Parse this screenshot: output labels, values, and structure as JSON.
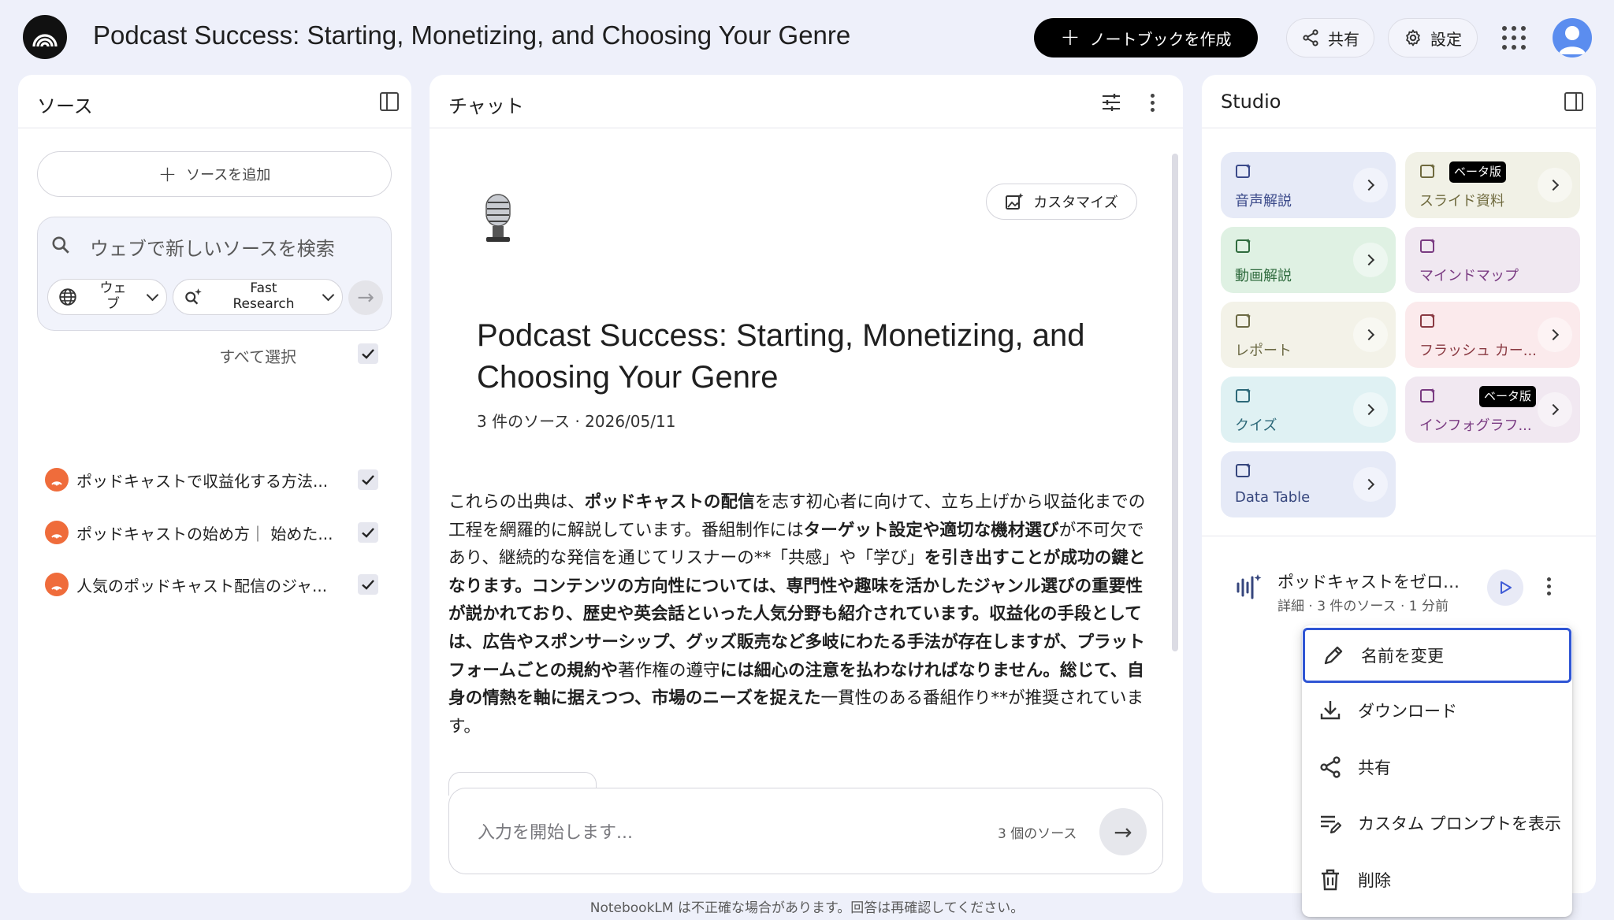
{
  "header": {
    "notebook_title": "Podcast Success: Starting, Monetizing, and Choosing Your Genre",
    "create_label": "ノートブックを作成",
    "share_label": "共有",
    "settings_label": "設定"
  },
  "sources": {
    "title": "ソース",
    "add_label": "ソースを追加",
    "search_placeholder": "ウェブで新しいソースを検索",
    "chip_web": "ウェ\nブ",
    "chip_fast": "Fast\nResearch",
    "select_all": "すべて選択",
    "items": [
      {
        "name": "ポッドキャストで収益化する方法..."
      },
      {
        "name": "ポッドキャストの始め方｜ 始めた..."
      },
      {
        "name": "人気のポッドキャスト配信のジャ..."
      }
    ]
  },
  "chat": {
    "title": "チャット",
    "customize_label": "カスタマイズ",
    "notebook_heading": "Podcast Success: Starting, Monetizing, and Choosing Your Genre",
    "meta": "3 件のソース · 2026/05/11",
    "summary": [
      {
        "t": "これらの出典は、",
        "b": false
      },
      {
        "t": "ポッドキャストの配信",
        "b": true
      },
      {
        "t": "を志す初心者に向けて、立ち上げから収益化までの工程を網羅的に解説しています。番組制作には",
        "b": false
      },
      {
        "t": "ターゲット設定や適切な機材選び",
        "b": true
      },
      {
        "t": "が不可欠であり、継続的な発信を通じてリスナーの**「共感」や「学び」",
        "b": false
      },
      {
        "t": "を引き出すことが成功の鍵となります。コンテンツの方向性については、専門性や趣味を活かしたジャンル選びの重要性が説かれており、歴史や英会話といった人気分野も紹介されています。収益化の手段としては、広告やスポンサーシップ、グッズ販売など多岐にわたる手法が存在しますが、プラットフォームごとの規約や",
        "b": true
      },
      {
        "t": "著作権の遵守",
        "b": false
      },
      {
        "t": "には細心の注意を払わなければなりません。総じて、自身の情熱を軸に据えつつ、市場のニーズを捉えた",
        "b": true
      },
      {
        "t": "一貫性のある番組作り**が推奨されています。",
        "b": false
      }
    ],
    "input_placeholder": "入力を開始します...",
    "source_count": "3 個のソース"
  },
  "studio": {
    "title": "Studio",
    "tiles": [
      {
        "label": "音声解説",
        "bg": "#e6eaf7",
        "fg": "#3b4a8a",
        "arrow": true
      },
      {
        "label": "スライド資料",
        "bg": "#f1f1e6",
        "fg": "#6f6a3e",
        "arrow": true,
        "beta": "ベータ版"
      },
      {
        "label": "動画解説",
        "bg": "#dff1e3",
        "fg": "#2f6b3e",
        "arrow": true
      },
      {
        "label": "マインドマップ",
        "bg": "#f0e8f1",
        "fg": "#7a3b82",
        "arrow": false
      },
      {
        "label": "レポート",
        "bg": "#f3f2e8",
        "fg": "#6c6a45",
        "arrow": true
      },
      {
        "label": "フラッシュ カー...",
        "bg": "#fbeaec",
        "fg": "#8a3a42",
        "arrow": true
      },
      {
        "label": "クイズ",
        "bg": "#dff1f3",
        "fg": "#2c6878",
        "arrow": true
      },
      {
        "label": "インフォグラフ...",
        "bg": "#f1e8f1",
        "fg": "#7a3b82",
        "arrow": true,
        "beta": "ベータ版"
      },
      {
        "label": "Data Table",
        "bg": "#e6eaf7",
        "fg": "#36467d",
        "arrow": true
      }
    ],
    "artifact": {
      "title": "ポッドキャストをゼロか...",
      "meta": "詳細 · 3 件のソース · 1 分前"
    }
  },
  "menu": {
    "rename": "名前を変更",
    "download": "ダウンロード",
    "share": "共有",
    "custom_prompt": "カスタム プロンプトを表示",
    "delete": "削除"
  },
  "footer": "NotebookLM は不正確な場合があります。回答は再確認してください。"
}
